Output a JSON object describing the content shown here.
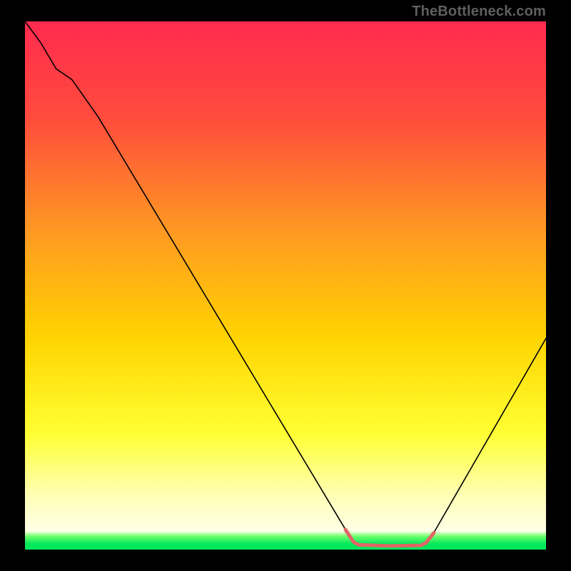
{
  "watermark": "TheBottleneck.com",
  "chart_data": {
    "type": "line",
    "title": "",
    "xlabel": "",
    "ylabel": "",
    "xlim": [
      0,
      100
    ],
    "ylim": [
      0,
      100
    ],
    "grid": false,
    "legend": false,
    "gradient_stops": [
      {
        "offset": 0.0,
        "color": "#ff2a4f"
      },
      {
        "offset": 0.18,
        "color": "#ff4b3d"
      },
      {
        "offset": 0.4,
        "color": "#ff9a22"
      },
      {
        "offset": 0.6,
        "color": "#ffd400"
      },
      {
        "offset": 0.78,
        "color": "#ffff33"
      },
      {
        "offset": 0.9,
        "color": "#ffffb8"
      },
      {
        "offset": 0.965,
        "color": "#ffffe6"
      },
      {
        "offset": 0.975,
        "color": "#6bff6b"
      },
      {
        "offset": 0.99,
        "color": "#00e85b"
      },
      {
        "offset": 1.0,
        "color": "#00e85b"
      }
    ],
    "series": [
      {
        "name": "bottleneck-curve-black",
        "color": "#000000",
        "width": 1.6,
        "points": [
          {
            "x": 0,
            "y": 100
          },
          {
            "x": 3,
            "y": 96
          },
          {
            "x": 6,
            "y": 91
          },
          {
            "x": 9,
            "y": 89
          },
          {
            "x": 14,
            "y": 82
          },
          {
            "x": 62,
            "y": 3
          },
          {
            "x": 63,
            "y": 1.5
          },
          {
            "x": 64,
            "y": 0.8
          },
          {
            "x": 76,
            "y": 0.7
          },
          {
            "x": 77,
            "y": 1.2
          },
          {
            "x": 78,
            "y": 2.4
          },
          {
            "x": 100,
            "y": 40
          }
        ]
      },
      {
        "name": "valley-highlight-red",
        "color": "#e06666",
        "width": 5,
        "points": [
          {
            "x": 61.5,
            "y": 3.8
          },
          {
            "x": 63,
            "y": 1.5
          },
          {
            "x": 64,
            "y": 0.9
          },
          {
            "x": 70,
            "y": 0.7
          },
          {
            "x": 76,
            "y": 0.8
          },
          {
            "x": 77,
            "y": 1.3
          },
          {
            "x": 78.5,
            "y": 3.2
          }
        ]
      }
    ]
  }
}
